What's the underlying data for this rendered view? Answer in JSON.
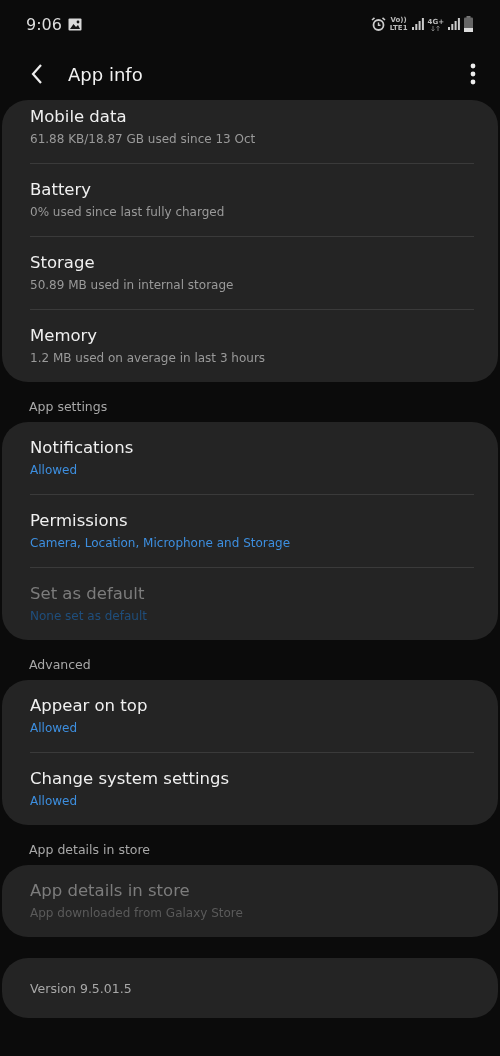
{
  "status_bar": {
    "time": "9:06",
    "volte_label": "Vo))",
    "sim_label": "LTE1",
    "network_label": "4G+"
  },
  "header": {
    "title": "App info"
  },
  "sections": [
    {
      "items": [
        {
          "title": "Mobile data",
          "subtitle": "61.88 KB/18.87 GB used since 13 Oct",
          "kind": "plain",
          "disabled": false
        },
        {
          "title": "Battery",
          "subtitle": "0% used since last fully charged",
          "kind": "plain",
          "disabled": false
        },
        {
          "title": "Storage",
          "subtitle": "50.89 MB used in internal storage",
          "kind": "plain",
          "disabled": false
        },
        {
          "title": "Memory",
          "subtitle": "1.2 MB used on average in last 3 hours",
          "kind": "plain",
          "disabled": false
        }
      ]
    },
    {
      "heading": "App settings",
      "items": [
        {
          "title": "Notifications",
          "subtitle": "Allowed",
          "kind": "accent",
          "disabled": false
        },
        {
          "title": "Permissions",
          "subtitle": "Camera, Location, Microphone and Storage",
          "kind": "accent",
          "disabled": false
        },
        {
          "title": "Set as default",
          "subtitle": "None set as default",
          "kind": "accent",
          "disabled": true
        }
      ]
    },
    {
      "heading": "Advanced",
      "items": [
        {
          "title": "Appear on top",
          "subtitle": "Allowed",
          "kind": "accent",
          "disabled": false
        },
        {
          "title": "Change system settings",
          "subtitle": "Allowed",
          "kind": "accent",
          "disabled": false
        }
      ]
    },
    {
      "heading": "App details in store",
      "items": [
        {
          "title": "App details in store",
          "subtitle": "App downloaded from Galaxy Store",
          "kind": "plain",
          "disabled": true
        }
      ]
    }
  ],
  "version": "Version 9.5.01.5"
}
